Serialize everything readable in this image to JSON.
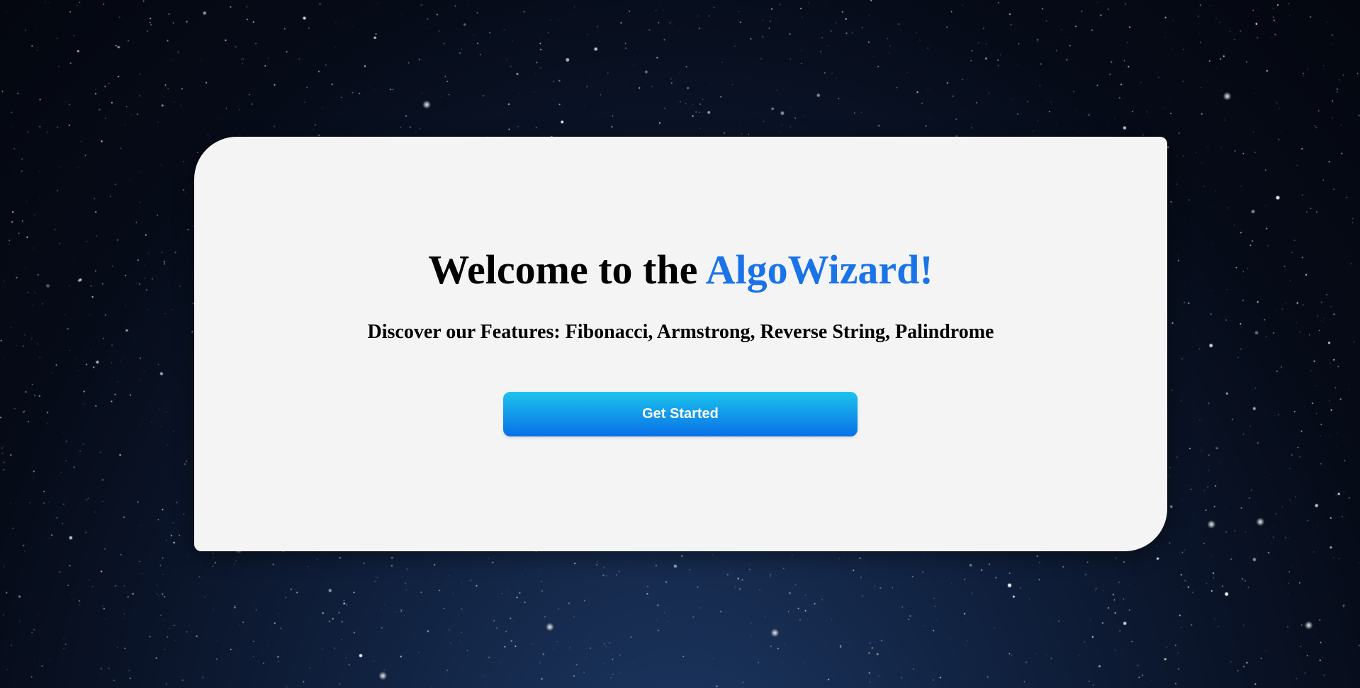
{
  "hero": {
    "title_prefix": "Welcome to the ",
    "title_brand": "AlgoWizard!",
    "subtitle": "Discover our Features: Fibonacci, Armstrong, Reverse String, Palindrome",
    "cta_label": "Get Started"
  },
  "colors": {
    "brand": "#1a73e8",
    "card_bg": "#f4f4f4",
    "button_gradient_top": "#1cc4ec",
    "button_gradient_bottom": "#0a70e8",
    "page_bg": "#0a1428"
  }
}
